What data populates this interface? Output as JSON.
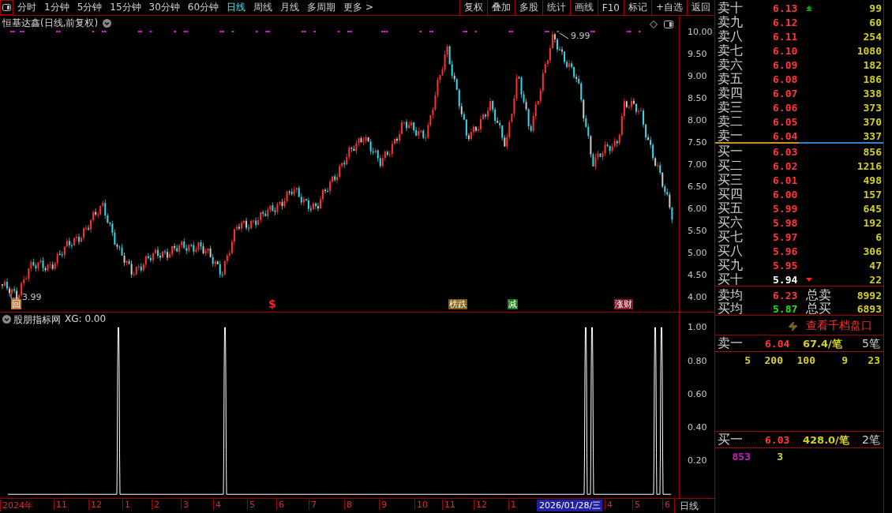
{
  "toolbar": {
    "periods": [
      {
        "label": "分时",
        "selected": false
      },
      {
        "label": "1分钟",
        "selected": false
      },
      {
        "label": "5分钟",
        "selected": false
      },
      {
        "label": "15分钟",
        "selected": false
      },
      {
        "label": "30分钟",
        "selected": false
      },
      {
        "label": "60分钟",
        "selected": false
      },
      {
        "label": "日线",
        "selected": true
      },
      {
        "label": "周线",
        "selected": false
      },
      {
        "label": "月线",
        "selected": false
      },
      {
        "label": "多周期",
        "selected": false
      },
      {
        "label": "更多 >",
        "selected": false
      }
    ],
    "actions": [
      "复权",
      "叠加",
      "多股",
      "统计",
      "画线",
      "F10",
      "标记",
      "+自选",
      "返回"
    ]
  },
  "chart": {
    "title": "恒基达鑫(日线,前复权)",
    "price_ticks": [
      "10.00",
      "9.50",
      "9.00",
      "8.50",
      "8.00",
      "7.50",
      "7.00",
      "6.50",
      "6.00",
      "5.50",
      "5.00",
      "4.50",
      "4.00"
    ],
    "high_label": "9.99",
    "low_label": "3.99",
    "markers": [
      {
        "text": "回",
        "kind": "boxed",
        "color": "#c87828"
      },
      {
        "text": "$",
        "kind": "plain",
        "color": "#ff2020"
      },
      {
        "text": "榜跌",
        "kind": "boxed",
        "color": "#7a5a10"
      },
      {
        "text": "减",
        "kind": "boxed",
        "color": "#1a7a1a"
      },
      {
        "text": "涨财",
        "kind": "boxed",
        "color": "#8a1a2a"
      }
    ]
  },
  "indicator": {
    "title": "股朋指标网",
    "reading": "XG: 0.00",
    "ticks": [
      "1.00",
      "0.80",
      "0.60",
      "0.40",
      "0.20"
    ]
  },
  "axis": {
    "labels": [
      {
        "label": "2024年",
        "selected": false
      },
      {
        "label": "11",
        "selected": false
      },
      {
        "label": "12",
        "selected": false
      },
      {
        "label": "1",
        "selected": false
      },
      {
        "label": "2",
        "selected": false
      },
      {
        "label": "3",
        "selected": false
      },
      {
        "label": "4",
        "selected": false
      },
      {
        "label": "5",
        "selected": false
      },
      {
        "label": "6",
        "selected": false
      },
      {
        "label": "7",
        "selected": false
      },
      {
        "label": "8",
        "selected": false
      },
      {
        "label": "9",
        "selected": false
      },
      {
        "label": "10",
        "selected": false
      },
      {
        "label": "11",
        "selected": false
      },
      {
        "label": "12",
        "selected": false
      },
      {
        "label": "1",
        "selected": false
      },
      {
        "label": "2026/01/28/三",
        "selected": true
      },
      {
        "label": "4",
        "selected": false
      },
      {
        "label": "5",
        "selected": false
      },
      {
        "label": "6",
        "selected": false
      }
    ],
    "period": "日线"
  },
  "order_book": {
    "asks": [
      {
        "label": "卖十",
        "price": "6.13",
        "volume": "99",
        "color": "#ff3838",
        "up_arrow": true,
        "down_arrow": false
      },
      {
        "label": "卖九",
        "price": "6.12",
        "volume": "60",
        "color": "#ff3838",
        "up_arrow": false,
        "down_arrow": false
      },
      {
        "label": "卖八",
        "price": "6.11",
        "volume": "254",
        "color": "#ff3838",
        "up_arrow": false,
        "down_arrow": false
      },
      {
        "label": "卖七",
        "price": "6.10",
        "volume": "1080",
        "color": "#ff3838",
        "up_arrow": false,
        "down_arrow": false
      },
      {
        "label": "卖六",
        "price": "6.09",
        "volume": "182",
        "color": "#ff3838",
        "up_arrow": false,
        "down_arrow": false
      },
      {
        "label": "卖五",
        "price": "6.08",
        "volume": "186",
        "color": "#ff3838",
        "up_arrow": false,
        "down_arrow": false
      },
      {
        "label": "卖四",
        "price": "6.07",
        "volume": "338",
        "color": "#ff3838",
        "up_arrow": false,
        "down_arrow": false
      },
      {
        "label": "卖三",
        "price": "6.06",
        "volume": "373",
        "color": "#ff3838",
        "up_arrow": false,
        "down_arrow": false
      },
      {
        "label": "卖二",
        "price": "6.05",
        "volume": "370",
        "color": "#ff3838",
        "up_arrow": false,
        "down_arrow": false
      },
      {
        "label": "卖一",
        "price": "6.04",
        "volume": "337",
        "color": "#ff3838",
        "up_arrow": false,
        "down_arrow": false
      }
    ],
    "bids": [
      {
        "label": "买一",
        "price": "6.03",
        "volume": "856",
        "color": "#ff3838",
        "up_arrow": false,
        "down_arrow": false
      },
      {
        "label": "买二",
        "price": "6.02",
        "volume": "1216",
        "color": "#ff3838",
        "up_arrow": false,
        "down_arrow": false
      },
      {
        "label": "买三",
        "price": "6.01",
        "volume": "498",
        "color": "#ff3838",
        "up_arrow": false,
        "down_arrow": false
      },
      {
        "label": "买四",
        "price": "6.00",
        "volume": "157",
        "color": "#ff3838",
        "up_arrow": false,
        "down_arrow": false
      },
      {
        "label": "买五",
        "price": "5.99",
        "volume": "645",
        "color": "#ff3838",
        "up_arrow": false,
        "down_arrow": false
      },
      {
        "label": "买六",
        "price": "5.98",
        "volume": "192",
        "color": "#ff3838",
        "up_arrow": false,
        "down_arrow": false
      },
      {
        "label": "买七",
        "price": "5.97",
        "volume": "6",
        "color": "#ff3838",
        "up_arrow": false,
        "down_arrow": false
      },
      {
        "label": "买八",
        "price": "5.96",
        "volume": "306",
        "color": "#ff3838",
        "up_arrow": false,
        "down_arrow": false
      },
      {
        "label": "买九",
        "price": "5.95",
        "volume": "47",
        "color": "#ff3838",
        "up_arrow": false,
        "down_arrow": false
      },
      {
        "label": "买十",
        "price": "5.94",
        "volume": "22",
        "color": "#ffffff",
        "up_arrow": false,
        "down_arrow": true
      }
    ],
    "summary": [
      {
        "label": "卖均",
        "price": "6.23",
        "color": "#ff3838",
        "total_label": "总卖",
        "total": "8992"
      },
      {
        "label": "买均",
        "price": "5.87",
        "color": "#20e020",
        "total_label": "总买",
        "total": "6893"
      }
    ],
    "depth_link": "查看千档盘口",
    "ask_detail": {
      "label": "卖一",
      "price": "6.04",
      "avg": "67.4/笔",
      "count": "5笔",
      "orders": [
        {
          "value": "5",
          "color": "#d4d020"
        },
        {
          "value": "200",
          "color": "#d4d020"
        },
        {
          "value": "100",
          "color": "#d4d020"
        },
        {
          "value": "9",
          "color": "#d4d020"
        },
        {
          "value": "23",
          "color": "#d4d020"
        }
      ]
    },
    "bid_detail": {
      "label": "买一",
      "price": "6.03",
      "avg": "428.0/笔",
      "count": "2笔",
      "orders": [
        {
          "value": "853",
          "color": "#c020c0"
        },
        {
          "value": "3",
          "color": "#d4d020"
        }
      ]
    }
  }
}
